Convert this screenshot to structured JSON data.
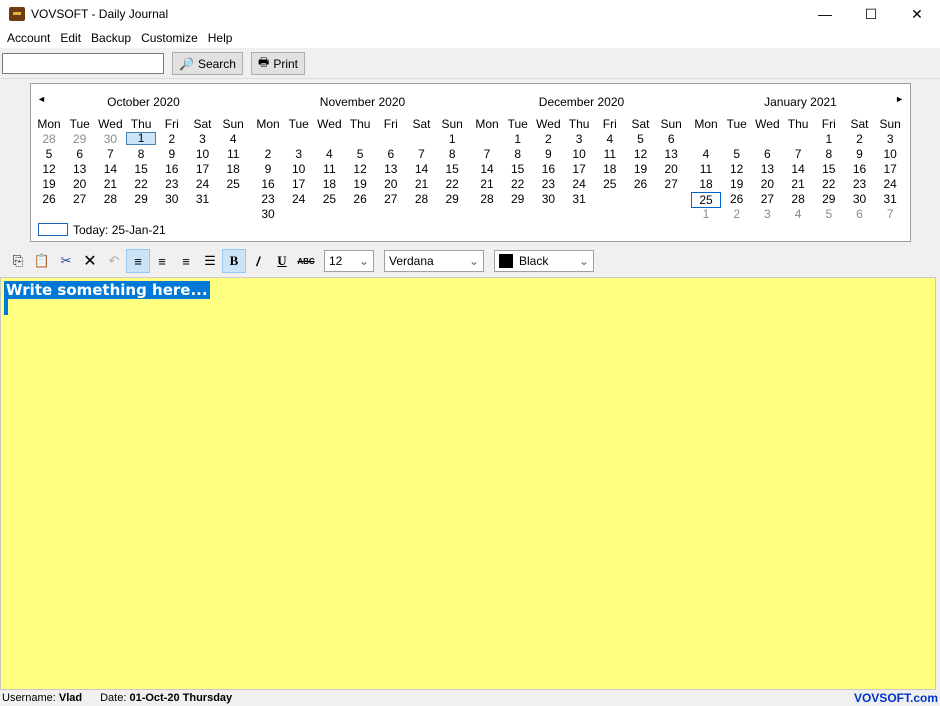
{
  "window": {
    "title": "VOVSOFT - Daily Journal",
    "minimize": "—",
    "maximize": "☐",
    "close": "✕"
  },
  "menu": [
    "Account",
    "Edit",
    "Backup",
    "Customize",
    "Help"
  ],
  "toolbar": {
    "search_value": "",
    "search_label": "Search",
    "print_label": "Print"
  },
  "calendar": {
    "weekdays": [
      "Mon",
      "Tue",
      "Wed",
      "Thu",
      "Fri",
      "Sat",
      "Sun"
    ],
    "months": [
      {
        "title": "October 2020",
        "year": 2020,
        "month": 10,
        "days": 31,
        "muted_before": [
          28,
          29,
          30
        ],
        "muted_after": []
      },
      {
        "title": "November 2020",
        "year": 2020,
        "month": 11,
        "days": 30,
        "muted_before": [],
        "muted_after": []
      },
      {
        "title": "December 2020",
        "year": 2020,
        "month": 12,
        "days": 31,
        "muted_before": [],
        "muted_after": []
      },
      {
        "title": "January 2021",
        "year": 2021,
        "month": 1,
        "days": 31,
        "muted_before": [],
        "muted_after": [
          1,
          2,
          3,
          4,
          5,
          6,
          7
        ]
      }
    ],
    "selected": "2020-10-1",
    "today": "2021-1-25",
    "today_label": "Today: 25-Jan-21",
    "prev": "◄",
    "next": "►"
  },
  "format": {
    "font_size": "12",
    "font_name": "Verdana",
    "color_name": "Black",
    "color": "#000000"
  },
  "editor": {
    "text": "Write something here...",
    "background": "#ffff80",
    "selection": "#0078d7"
  },
  "status": {
    "username_label": "Username:",
    "username": "Vlad",
    "date_label": "Date:",
    "date": "01-Oct-20 Thursday",
    "brand": "VOVSOFT.com"
  }
}
